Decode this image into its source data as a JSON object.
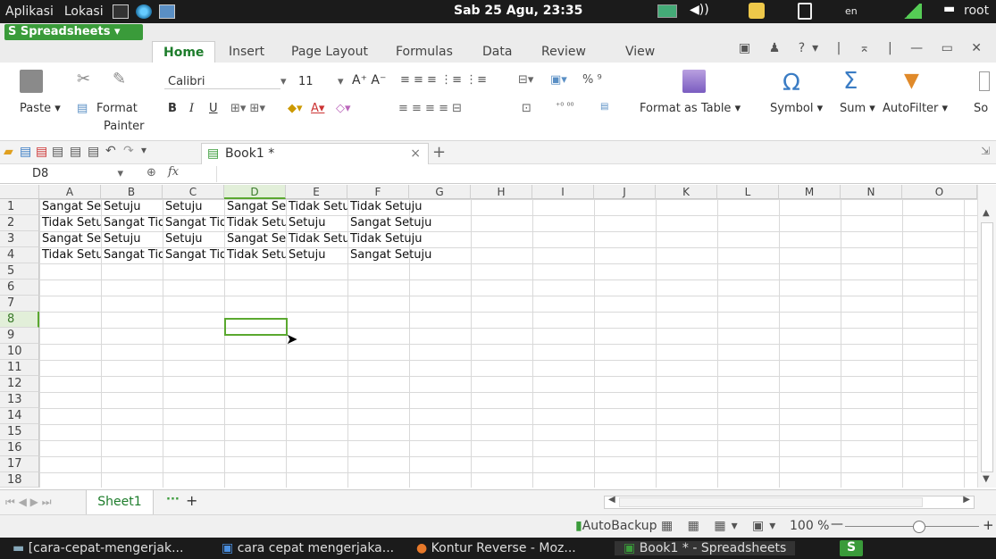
{
  "topbar": {
    "menu_apps": "Aplikasi",
    "menu_places": "Lokasi",
    "clock": "Sab 25 Agu, 23:35",
    "lang": "en",
    "user": "root"
  },
  "ribbon": {
    "app_button": "Spreadsheets",
    "tabs": [
      "Home",
      "Insert",
      "Page Layout",
      "Formulas",
      "Data",
      "Review",
      "View"
    ],
    "paste": "Paste",
    "format": "Format",
    "painter": "Painter",
    "font_name": "Calibri",
    "font_size": "11",
    "number_format": "% ⁹",
    "format_as_table": "Format as Table",
    "symbol": "Symbol",
    "sum": "Sum",
    "autofilter": "AutoFilter",
    "sort_partial": "So"
  },
  "doc": {
    "tab_title": "Book1 *",
    "name_box": "D8",
    "fx": "fx"
  },
  "columns": [
    "A",
    "B",
    "C",
    "D",
    "E",
    "F",
    "G",
    "H",
    "I",
    "J",
    "K",
    "L",
    "M",
    "N",
    "O"
  ],
  "rows": [
    "1",
    "2",
    "3",
    "4",
    "5",
    "6",
    "7",
    "8",
    "9",
    "10",
    "11",
    "12",
    "13",
    "14",
    "15",
    "16",
    "17",
    "18"
  ],
  "cells": [
    [
      "Sangat Se",
      "Setuju",
      "Setuju",
      "Sangat Se",
      "Tidak Setu",
      "Tidak Setuju"
    ],
    [
      "Tidak Setu",
      "Sangat Tid",
      "Sangat Tid",
      "Tidak Setu",
      "Setuju",
      "Sangat Setuju"
    ],
    [
      "Sangat Se",
      "Setuju",
      "Setuju",
      "Sangat Se",
      "Tidak Setu",
      "Tidak Setuju"
    ],
    [
      "Tidak Setu",
      "Sangat Tid",
      "Sangat Tid",
      "Tidak Setu",
      "Setuju",
      "Sangat Setuju"
    ]
  ],
  "sheet": {
    "name": "Sheet1",
    "more": "···",
    "add": "+"
  },
  "status": {
    "autobackup": "AutoBackup",
    "zoom": "100 %",
    "zoom_level": 0.55
  },
  "taskbar": {
    "items": [
      "[cara-cepat-mengerjak...",
      "cara cepat mengerjaka...",
      "Kontur Reverse - Moz...",
      "Book1 * - Spreadsheets"
    ]
  },
  "colors": {
    "accent_green": "#3a9b3a",
    "selection": "#5aa82f"
  }
}
